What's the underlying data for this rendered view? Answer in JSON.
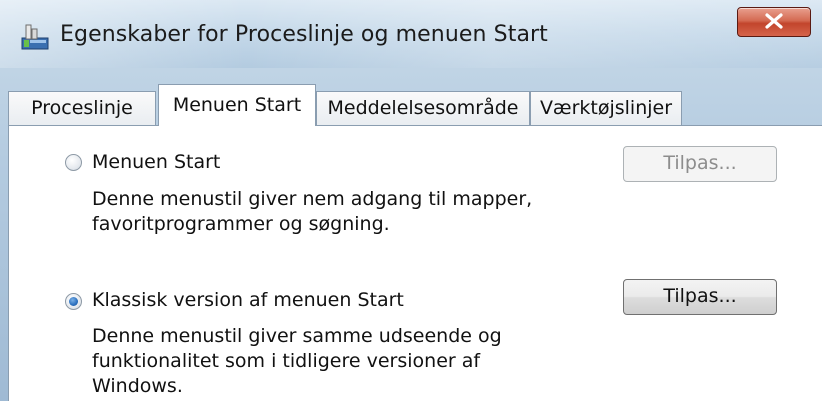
{
  "window": {
    "title": "Egenskaber for Proceslinje og menuen Start",
    "close_icon": "close-icon",
    "app_icon": "taskbar-properties-icon"
  },
  "tabs": [
    {
      "label": "Proceslinje",
      "active": false
    },
    {
      "label": "Menuen Start",
      "active": true
    },
    {
      "label": "Meddelelsesområde",
      "active": false
    },
    {
      "label": "Værktøjslinjer",
      "active": false
    }
  ],
  "options": [
    {
      "label": "Menuen Start",
      "description": "Denne menustil giver nem adgang til mapper,\nfavoritprogrammer og søgning.",
      "selected": false,
      "button_label": "Tilpas...",
      "button_enabled": false
    },
    {
      "label": "Klassisk version af menuen Start",
      "description": "Denne menustil giver samme udseende og\nfunktionalitet som i tidligere versioner af\nWindows.",
      "selected": true,
      "button_label": "Tilpas...",
      "button_enabled": true
    }
  ],
  "colors": {
    "accent": "#2a6fbe",
    "close_button": "#c2452c"
  }
}
